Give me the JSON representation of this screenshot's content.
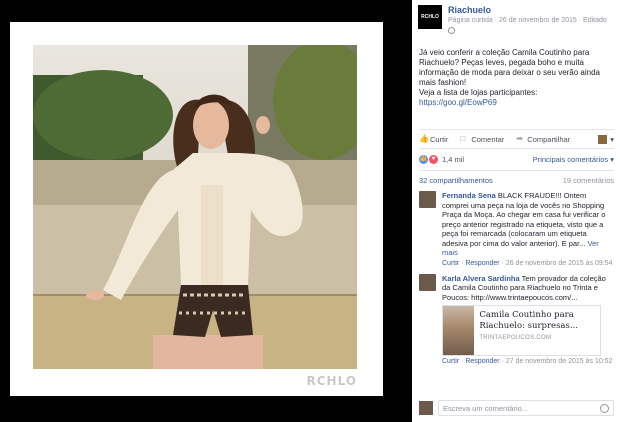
{
  "photo": {
    "watermark": "RCHLO"
  },
  "page": {
    "logo_text": "RCHLO",
    "name": "Riachuelo",
    "meta": "Página curtida · 26 de novembro de 2015 · Editado"
  },
  "post": {
    "text": "Já veio conferir a coleção Camila Coutinho para Riachuelo? Peças leves, pegada boho e muita informação de moda para deixar o seu verão ainda mais fashion!",
    "cta": "Veja a lista de lojas participantes:",
    "link": "https://goo.gl/EowP69"
  },
  "actions": {
    "like": "Curtir",
    "comment": "Comentar",
    "share": "Compartilhar",
    "caret": "▾"
  },
  "reactions": {
    "count": "1,4 mil",
    "sort_label": "Principais comentários ▾"
  },
  "stats": {
    "shares": "32 compartilhamentos",
    "comments": "19 comentários"
  },
  "comments": [
    {
      "name": "Fernanda Sena",
      "text": " BLACK FRAUDE!!! Ontem comprei uma peça na loja de vocês no Shopping Praça da Moça. Ao chegar em casa fui verificar o preço anterior registrado na etiqueta, visto que a peça foi remarcada (colocaram um etiqueta adesiva por cima do valor anterior). E par...",
      "more": " Ver mais",
      "like": "Curtir",
      "reply": "Responder",
      "time": " · 26 de novembro de 2015 às 09:54"
    },
    {
      "name": "Karla Alvera Sardinha",
      "text": " Tem provador da coleção da Camila Coutinho para Riachuelo no Trinta e Poucos: http://www.trintaepoucos.com/...",
      "like": "Curtir",
      "reply": "Responder",
      "time": " · 27 de novembro de 2015 às 10:52",
      "preview": {
        "title": "Camila Coutinho para Riachuelo: surpresas...",
        "domain": "TRINTAEPOUCOS.COM"
      }
    }
  ],
  "composer": {
    "placeholder": "Escreva um comentário..."
  },
  "icons": {
    "like": "thumbs-up-icon",
    "comment": "speech-bubble-icon",
    "share": "share-arrow-icon",
    "globe": "globe-icon",
    "camera": "camera-icon"
  },
  "colors": {
    "link": "#365899",
    "like_reaction": "#5890ff",
    "love_reaction": "#f25268"
  }
}
